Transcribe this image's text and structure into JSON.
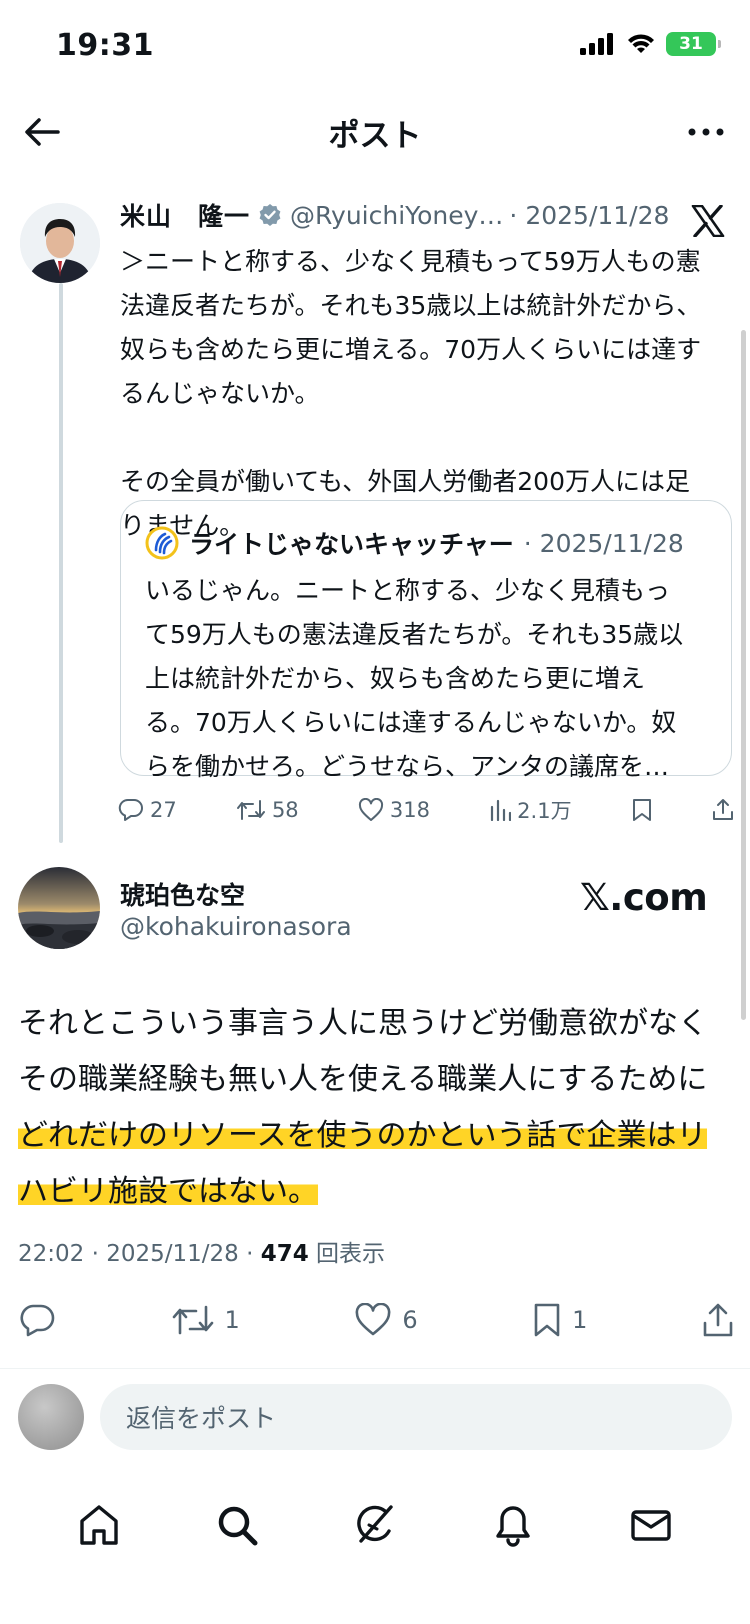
{
  "status": {
    "time": "19:31",
    "battery": "31"
  },
  "nav": {
    "title": "ポスト"
  },
  "quoted_post": {
    "author": "米山　隆一",
    "handle": "@RyuichiYoney…",
    "date": "· 2025/11/28",
    "text_lines": [
      "＞ニートと称する、少なく見積もって59万人もの憲",
      "法違反者たちが。それも35歳以上は統計外だから、",
      "奴らも含めたら更に増える。70万人くらいには達す",
      "るんじゃないか。",
      "",
      "その全員が働いても、外国人労働者200万人には足",
      "りません。"
    ],
    "inner_quote": {
      "author": "ライトじゃないキャッチャー",
      "date": "· 2025/11/28",
      "text_lines": [
        "いるじゃん。ニートと称する、少なく見積もっ",
        "て59万人もの憲法違反者たちが。それも35歳以",
        "上は統計外だから、奴らも含めたら更に増え",
        "る。70万人くらいには達するんじゃないか。奴",
        "らを働かせろ。どうせなら、アンタの議席を…"
      ]
    },
    "actions": {
      "replies": "27",
      "reposts": "58",
      "likes": "318",
      "views": "2.1万"
    }
  },
  "reply_post": {
    "author": "琥珀色な空",
    "handle": "@kohakuironasora",
    "badge": "𝕏.com",
    "text_lines": [
      "それとこういう事言う人に思うけど労働意欲がなく",
      "その職業経験も無い人を使える職業人にするために",
      "どれだけのリソースを使うのかという話で企業はリ",
      "ハビリ施設ではない。"
    ],
    "highlight_color": "#ffcd00",
    "meta": {
      "time_date": "22:02 · 2025/11/28 · ",
      "views_count": "474",
      "views_label": " 回表示"
    },
    "actions": {
      "reposts": "1",
      "likes": "6",
      "bookmarks": "1"
    }
  },
  "composer": {
    "placeholder": "返信をポスト"
  },
  "tabs": [
    "home",
    "search",
    "grok",
    "notifications",
    "messages"
  ],
  "colors": {
    "text": "#0f1419",
    "secondary": "#536471",
    "border": "#cfd9de",
    "verified": "#829aab",
    "battery": "#34c759"
  }
}
